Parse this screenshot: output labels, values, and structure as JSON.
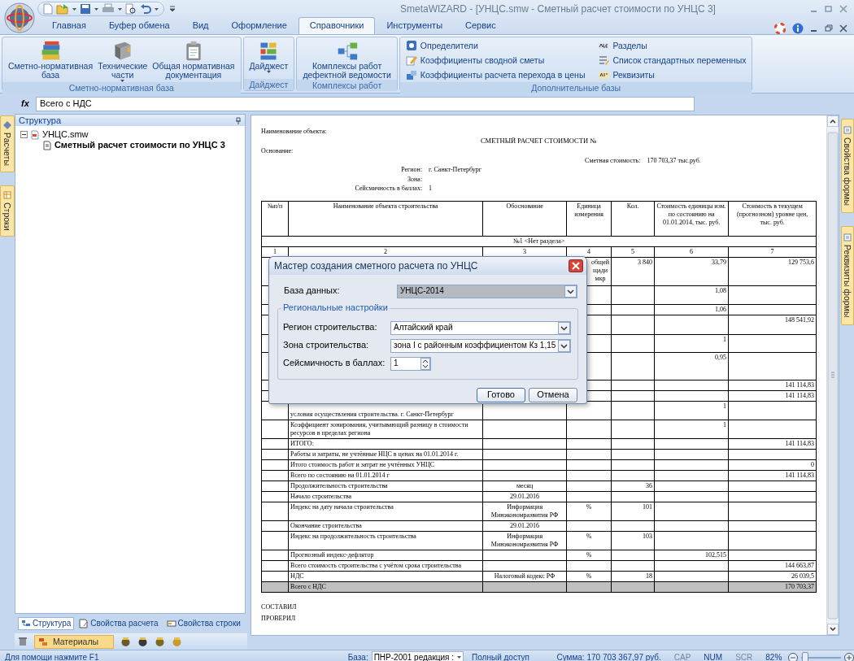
{
  "window": {
    "title": "SmetaWIZARD - [УНЦС.smw - Сметный расчет стоимости по УНЦС 3]"
  },
  "ribbon_tabs": [
    {
      "label": "Главная",
      "selected": false
    },
    {
      "label": "Буфер обмена",
      "selected": false
    },
    {
      "label": "Вид",
      "selected": false
    },
    {
      "label": "Оформление",
      "selected": false
    },
    {
      "label": "Справочники",
      "selected": true
    },
    {
      "label": "Инструменты",
      "selected": false
    },
    {
      "label": "Сервис",
      "selected": false
    }
  ],
  "ribbon_groups": [
    {
      "label": "Сметно-нормативная база",
      "kind": "large",
      "buttons": [
        {
          "label": "Сметно-нормативная\nбаза",
          "dropdown": false
        },
        {
          "label": "Технические\nчасти",
          "dropdown": true
        },
        {
          "label": "Общая нормативная\nдокументация",
          "dropdown": false
        }
      ]
    },
    {
      "label": "Дайджест",
      "kind": "large",
      "buttons": [
        {
          "label": "Дайджест",
          "dropdown": true
        }
      ]
    },
    {
      "label": "Комплексы работ",
      "kind": "large",
      "buttons": [
        {
          "label": "Комплексы работ\nдефектной ведомости",
          "dropdown": false
        }
      ]
    },
    {
      "label": "Дополнительные базы",
      "kind": "small",
      "buttons": [
        {
          "label": "Определители"
        },
        {
          "label": "Коэффициенты сводной сметы"
        },
        {
          "label": "Коэффициенты расчета перехода в цены"
        },
        {
          "label": "Разделы"
        },
        {
          "label": "Список стандартных переменных"
        },
        {
          "label": "Реквизиты"
        }
      ]
    }
  ],
  "formula_bar": {
    "label": "fx",
    "value": "Всего с НДС"
  },
  "left_side_tabs": [
    "Расчеты",
    "Строки"
  ],
  "right_side_tabs": [
    "Свойства формы",
    "Реквизиты формы"
  ],
  "structure_panel": {
    "title": "Структура",
    "tree": [
      {
        "label": "УНЦС.smw",
        "expanded": true,
        "selected": false,
        "children": [
          {
            "label": "Сметный расчет стоимости по УНЦС 3",
            "selected": true
          }
        ]
      }
    ]
  },
  "panel_tabs": [
    {
      "label": "Структура",
      "selected": true
    },
    {
      "label": "Свойства расчета",
      "selected": false
    },
    {
      "label": "Свойства строки",
      "selected": false
    }
  ],
  "materials_toolbar": {
    "label": "Материалы",
    "selected": true
  },
  "document": {
    "object_label": "Наименование объекта:",
    "title": "СМЕТНЫЙ РАСЧЕТ СТОИМОСТИ №",
    "basis_label": "Основание:",
    "cost_label": "Сметная стоимость:",
    "cost_value": "170 703,37 тыс.руб.",
    "fields": [
      {
        "label": "Регион:",
        "value": "г. Санкт-Петербург"
      },
      {
        "label": "Зона:"
      },
      {
        "label": "Сейсмичность в баллах:",
        "value": "1"
      }
    ],
    "table": {
      "columns": [
        "№п/п",
        "Наименование объекта строительства",
        "Обоснование",
        "Единица измерения",
        "Кол.",
        "Стоимость единицы изм. по состоянию на 01.01.2014, тыс. руб.",
        "Стоимость в текущем (прогнозном) уровне цен, тыс. руб."
      ],
      "section": "№1 <Нет раздела>",
      "column_numbers": [
        "1",
        "2",
        "3",
        "4",
        "5",
        "6",
        "7"
      ],
      "rows": [
        {
          "unit": "общей щади мкр",
          "quantity": "3 840",
          "unit_cost": "33,79",
          "total": "129 753,6",
          "selected": false
        },
        {
          "unit_cost": "1,08",
          "selected": false
        },
        {
          "unit_cost": "1,06",
          "selected": false
        },
        {
          "total": "148 541,92",
          "selected": false
        },
        {
          "unit_cost": "1",
          "selected": false
        },
        {
          "unit_cost": "0,95",
          "selected": false
        },
        {
          "total": "141 114,83",
          "selected": false
        },
        {
          "total": "141 114,83",
          "selected": false
        },
        {
          "item": "условия осуществления строительства. г. Санкт-Петербург",
          "unit_cost": "1",
          "selected": false
        },
        {
          "item": "Коэффициент зонирования, учитывающий разницу в стоимости ресурсов в пределах региона",
          "unit_cost": "1",
          "selected": false
        },
        {
          "item": "ИТОГО:",
          "total": "141 114,83",
          "selected": false
        },
        {
          "item": "Работы и затраты, не учтённые НЦС в ценах на 01.01.2014 г.",
          "selected": false
        },
        {
          "item": "Итого стоимость работ и затрат не учтённых УНЦС",
          "total": "0",
          "selected": false
        },
        {
          "item": "Всего по состоянию на 01.01.2014 г",
          "total": "141 114,83",
          "selected": false
        },
        {
          "item": "Продолжительность строительства",
          "basis": "месяц",
          "quantity": "36",
          "selected": false
        },
        {
          "item": "Начало строительства",
          "basis": "29.01.2016",
          "selected": false
        },
        {
          "item": "Индекс на дату начала строительства",
          "basis": "Информация Минэкономразвития РФ",
          "unit": "%",
          "quantity": "101",
          "selected": false
        },
        {
          "item": "Окончание строительства",
          "basis": "29.01.2016",
          "selected": false
        },
        {
          "item": "Индекс на продолжительность строительства",
          "basis": "Информация Минэкономразвития РФ",
          "unit": "%",
          "quantity": "103",
          "selected": false
        },
        {
          "item": "Прогнозный индекс-дефлятор",
          "unit": "%",
          "unit_cost": "102,515",
          "selected": false
        },
        {
          "item": "Всего стоимость строительства с учётом срока строительства",
          "total": "144 663,87",
          "selected": false
        },
        {
          "item": "НДС",
          "basis": "Налоговый кодекс РФ",
          "unit": "%",
          "quantity": "18",
          "total": "26 039,5",
          "selected": false
        },
        {
          "item": "Всего с НДС",
          "total": "170 703,37",
          "selected": true
        }
      ]
    },
    "signatures": [
      "СОСТАВИЛ",
      "ПРОВЕРИЛ"
    ]
  },
  "dialog": {
    "title": "Мастер создания сметного расчета по УНЦС",
    "database_label": "База данных:",
    "database_value": "УНЦС-2014",
    "group_label": "Региональные настройки",
    "fields": [
      {
        "label": "Регион строительства:",
        "value": "Алтайский край",
        "kind": "combo"
      },
      {
        "label": "Зона строительства:",
        "value": "зона I с районным коэффициентом Кз 1,15",
        "kind": "combo"
      },
      {
        "label": "Сейсмичность в баллах:",
        "value": "1",
        "kind": "spin"
      }
    ],
    "buttons": [
      {
        "label": "Готово",
        "default": true
      },
      {
        "label": "Отмена",
        "default": false
      }
    ]
  },
  "status_bar": {
    "help": "Для помощи нажмите F1",
    "base_label": "База:",
    "base_value": "ПНР-2001 редакция :",
    "access": "Полный доступ",
    "sum": "Сумма: 170 703 367,97 руб.",
    "indicators": [
      {
        "label": "CAP",
        "on": false
      },
      {
        "label": "NUM",
        "on": true
      },
      {
        "label": "SCR",
        "on": false
      }
    ],
    "zoom": "82%",
    "zoom_slider": {
      "level": 0.1
    }
  }
}
